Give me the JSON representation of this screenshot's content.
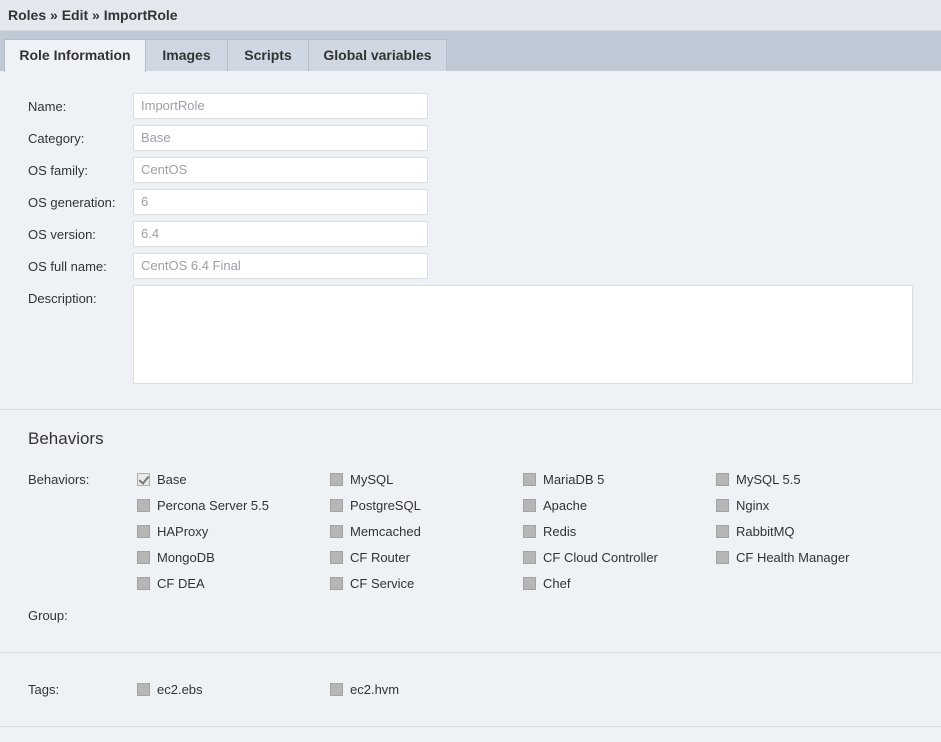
{
  "breadcrumb": "Roles » Edit » ImportRole",
  "tabs": [
    {
      "label": "Role Information"
    },
    {
      "label": "Images"
    },
    {
      "label": "Scripts"
    },
    {
      "label": "Global variables"
    }
  ],
  "form": {
    "name": {
      "label": "Name:",
      "value": "ImportRole"
    },
    "category": {
      "label": "Category:",
      "value": "Base"
    },
    "os_family": {
      "label": "OS family:",
      "value": "CentOS"
    },
    "os_generation": {
      "label": "OS generation:",
      "value": "6"
    },
    "os_version": {
      "label": "OS version:",
      "value": "6.4"
    },
    "os_full_name": {
      "label": "OS full name:",
      "value": "CentOS 6.4 Final"
    },
    "description": {
      "label": "Description:",
      "value": ""
    }
  },
  "behaviors_section": {
    "title": "Behaviors",
    "label": "Behaviors:",
    "group_label": "Group:",
    "items": [
      {
        "label": "Base",
        "checked": true
      },
      {
        "label": "MySQL",
        "checked": false
      },
      {
        "label": "MariaDB 5",
        "checked": false
      },
      {
        "label": "MySQL 5.5",
        "checked": false
      },
      {
        "label": "Percona Server 5.5",
        "checked": false
      },
      {
        "label": "PostgreSQL",
        "checked": false
      },
      {
        "label": "Apache",
        "checked": false
      },
      {
        "label": "Nginx",
        "checked": false
      },
      {
        "label": "HAProxy",
        "checked": false
      },
      {
        "label": "Memcached",
        "checked": false
      },
      {
        "label": "Redis",
        "checked": false
      },
      {
        "label": "RabbitMQ",
        "checked": false
      },
      {
        "label": "MongoDB",
        "checked": false
      },
      {
        "label": "CF Router",
        "checked": false
      },
      {
        "label": "CF Cloud Controller",
        "checked": false
      },
      {
        "label": "CF Health Manager",
        "checked": false
      },
      {
        "label": "CF DEA",
        "checked": false
      },
      {
        "label": "CF Service",
        "checked": false
      },
      {
        "label": "Chef",
        "checked": false
      }
    ]
  },
  "tags_section": {
    "label": "Tags:",
    "items": [
      {
        "label": "ec2.ebs",
        "checked": false
      },
      {
        "label": "ec2.hvm",
        "checked": false
      }
    ]
  }
}
